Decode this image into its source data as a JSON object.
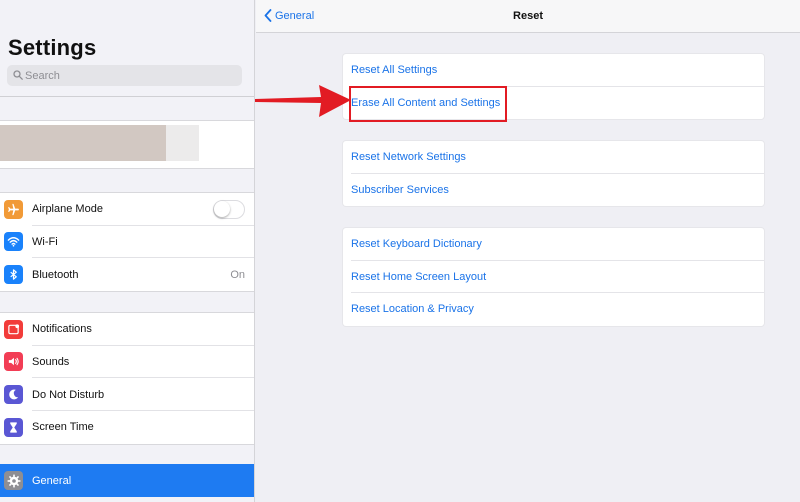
{
  "sidebar": {
    "title": "Settings",
    "search_placeholder": "Search",
    "group1": [
      {
        "label": "Airplane Mode",
        "icon": "airplane-icon",
        "color": "#f19a37",
        "control": "toggle",
        "toggle_on": false
      },
      {
        "label": "Wi-Fi",
        "icon": "wifi-icon",
        "color": "#1a82fb"
      },
      {
        "label": "Bluetooth",
        "icon": "bluetooth-icon",
        "color": "#1a82fb",
        "value": "On"
      }
    ],
    "group2": [
      {
        "label": "Notifications",
        "icon": "notifications-icon",
        "color": "#f23c3a"
      },
      {
        "label": "Sounds",
        "icon": "sounds-icon",
        "color": "#f23d55"
      },
      {
        "label": "Do Not Disturb",
        "icon": "moon-icon",
        "color": "#5a57d4"
      },
      {
        "label": "Screen Time",
        "icon": "hourglass-icon",
        "color": "#5a57d4"
      }
    ],
    "selected": {
      "label": "General",
      "icon": "gear-icon",
      "color": "#8e8e93"
    },
    "selection_color": "#1e7bf2"
  },
  "nav": {
    "back_label": "General",
    "title": "Reset"
  },
  "detail": {
    "groups": [
      [
        {
          "label": "Reset All Settings"
        },
        {
          "label": "Erase All Content and Settings",
          "highlighted": true
        }
      ],
      [
        {
          "label": "Reset Network Settings"
        },
        {
          "label": "Subscriber Services"
        }
      ],
      [
        {
          "label": "Reset Keyboard Dictionary"
        },
        {
          "label": "Reset Home Screen Layout"
        },
        {
          "label": "Reset Location & Privacy"
        }
      ]
    ],
    "link_color": "#1a73e8",
    "annotation_color": "#e21b23"
  }
}
